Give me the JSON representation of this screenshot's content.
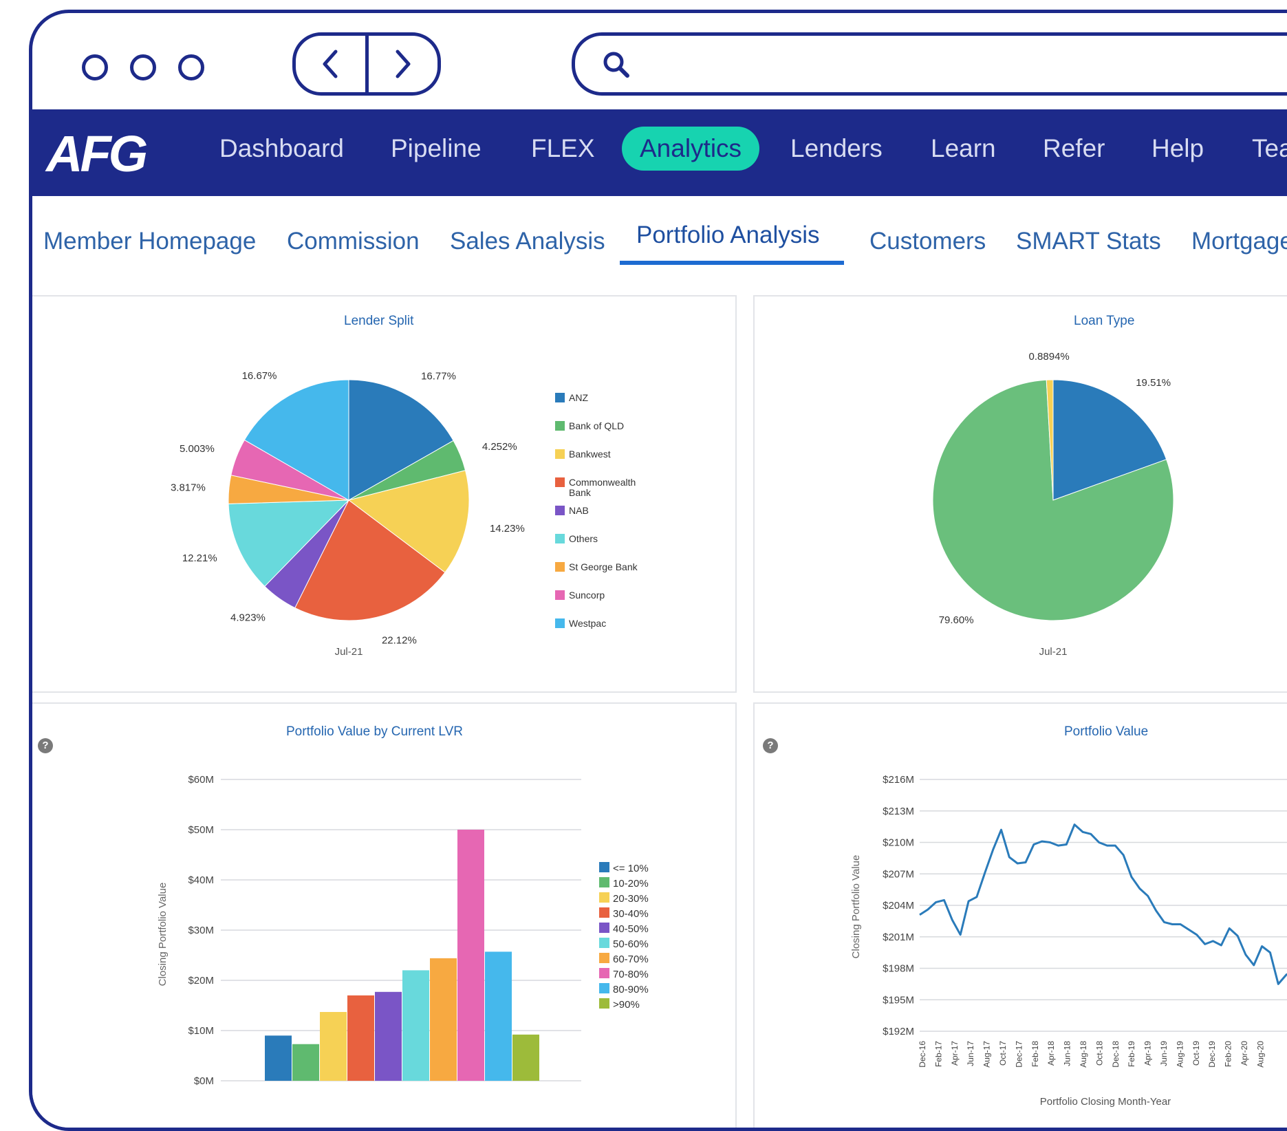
{
  "browser": {
    "window_dots": [
      "circle",
      "circle",
      "circle"
    ],
    "back_icon": "chevron-left-icon",
    "forward_icon": "chevron-right-icon",
    "search_icon": "search-icon",
    "url": ""
  },
  "nav": {
    "logo": "AFG",
    "items": [
      "Dashboard",
      "Pipeline",
      "FLEX",
      "Analytics",
      "Lenders",
      "Learn",
      "Refer",
      "Help",
      "Tea"
    ],
    "active": "Analytics",
    "colors": {
      "bar": "#1d2a8a",
      "active_pill": "#17d3b0"
    }
  },
  "subnav": {
    "items": [
      "Member Homepage",
      "Commission",
      "Sales Analysis",
      "Portfolio Analysis",
      "Customers",
      "SMART Stats",
      "Mortgage"
    ],
    "active": "Portfolio Analysis"
  },
  "panels": {
    "lender_split": {
      "title": "Lender Split"
    },
    "loan_type": {
      "title": "Loan Type"
    },
    "lvr": {
      "title": "Portfolio Value by Current LVR",
      "help": "?"
    },
    "portfolio_value": {
      "title": "Portfolio Value",
      "help": "?"
    }
  },
  "chart_data": [
    {
      "id": "lender_split",
      "type": "pie",
      "title": "Lender Split",
      "xlabel": "Jul-21",
      "slices": [
        {
          "label": "ANZ",
          "value": 16.77,
          "display": "16.77%",
          "color": "#2a7bba"
        },
        {
          "label": "Bank of QLD",
          "value": 4.252,
          "display": "4.252%",
          "color": "#5fba6f"
        },
        {
          "label": "Bankwest",
          "value": 14.23,
          "display": "14.23%",
          "color": "#f6d155"
        },
        {
          "label": "Commonwealth Bank",
          "value": 22.12,
          "display": "22.12%",
          "color": "#e8613f"
        },
        {
          "label": "NAB",
          "value": 4.923,
          "display": "4.923%",
          "color": "#7a55c6"
        },
        {
          "label": "Others",
          "value": 12.21,
          "display": "12.21%",
          "color": "#68d9dc"
        },
        {
          "label": "St George Bank",
          "value": 3.817,
          "display": "3.817%",
          "color": "#f7a941"
        },
        {
          "label": "Suncorp",
          "value": 5.003,
          "display": "5.003%",
          "color": "#e667b3"
        },
        {
          "label": "Westpac",
          "value": 16.67,
          "display": "16.67%",
          "color": "#45b8ec"
        }
      ],
      "legend_placement": "right"
    },
    {
      "id": "loan_type",
      "type": "pie",
      "title": "Loan Type",
      "xlabel": "Jul-21",
      "slices": [
        {
          "label": "",
          "value": 19.51,
          "display": "19.51%",
          "color": "#2a7bba"
        },
        {
          "label": "",
          "value": 79.6,
          "display": "79.60%",
          "color": "#6abf7c"
        },
        {
          "label": "",
          "value": 0.8894,
          "display": "0.8894%",
          "color": "#f6d155"
        }
      ],
      "legend_placement": "right"
    },
    {
      "id": "lvr",
      "type": "bar",
      "title": "Portfolio Value by Current LVR",
      "ylabel": "Closing Portfolio Value",
      "yticks": [
        "$0M",
        "$10M",
        "$20M",
        "$30M",
        "$40M",
        "$50M",
        "$60M"
      ],
      "ylim": [
        0,
        60
      ],
      "categories": [
        "<= 10%",
        "10-20%",
        "20-30%",
        "30-40%",
        "40-50%",
        "50-60%",
        "60-70%",
        "70-80%",
        "80-90%",
        ">90%"
      ],
      "values": [
        9,
        7.3,
        13.7,
        17,
        17.7,
        22,
        24.4,
        50,
        25.7,
        9.2
      ],
      "colors": [
        "#2a7bba",
        "#5fba6f",
        "#f6d155",
        "#e8613f",
        "#7a55c6",
        "#68d9dc",
        "#f7a941",
        "#e667b3",
        "#45b8ec",
        "#9dbb3a"
      ],
      "legend_placement": "right",
      "grid": true
    },
    {
      "id": "portfolio_value",
      "type": "line",
      "title": "Portfolio Value",
      "ylabel": "Closing Portfolio Value",
      "xlabel": "Portfolio Closing Month-Year",
      "yticks": [
        "$192M",
        "$195M",
        "$198M",
        "$201M",
        "$204M",
        "$207M",
        "$210M",
        "$213M",
        "$216M"
      ],
      "ylim": [
        192,
        216
      ],
      "xticks": [
        "Dec-16",
        "Feb-17",
        "Apr-17",
        "Jun-17",
        "Aug-17",
        "Oct-17",
        "Dec-17",
        "Feb-18",
        "Apr-18",
        "Jun-18",
        "Aug-18",
        "Oct-18",
        "Dec-18",
        "Feb-19",
        "Apr-19",
        "Jun-19",
        "Aug-19",
        "Oct-19",
        "Dec-19",
        "Feb-20",
        "Apr-20",
        "Aug-20"
      ],
      "series": [
        {
          "color": "#2a7bba",
          "values": [
            203.1,
            203.6,
            204.3,
            204.5,
            202.6,
            201.2,
            204.4,
            204.8,
            207.1,
            209.3,
            211.2,
            208.6,
            208.0,
            208.1,
            209.8,
            210.1,
            210.0,
            209.7,
            209.8,
            211.7,
            211.0,
            210.8,
            210.0,
            209.7,
            209.7,
            208.8,
            206.7,
            205.6,
            204.9,
            203.5,
            202.4,
            202.2,
            202.2,
            201.7,
            201.2,
            200.3,
            200.6,
            200.2,
            201.8,
            201.1,
            199.3,
            198.3,
            200.1,
            199.5,
            196.5,
            197.4,
            197.6
          ]
        }
      ],
      "grid": true
    }
  ]
}
